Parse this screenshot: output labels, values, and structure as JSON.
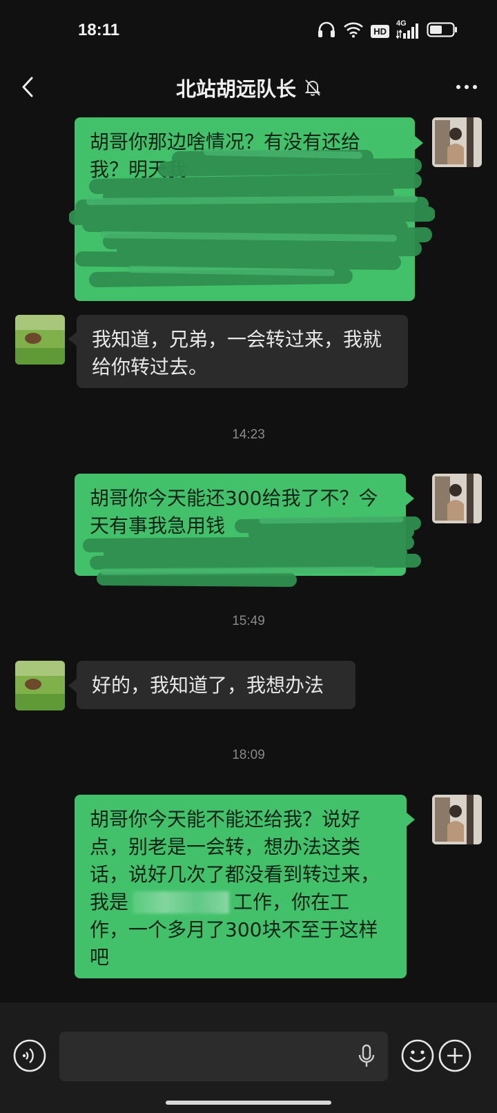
{
  "status_bar": {
    "time": "18:11",
    "icons": [
      "headphones-icon",
      "wifi-icon",
      "hd-icon",
      "4g-signal-icon",
      "battery-icon"
    ],
    "hd_label": "HD",
    "network_label": "4G"
  },
  "header": {
    "title": "北站胡远队长",
    "muted_icon": "bell-off-icon",
    "back_icon": "chevron-left-icon",
    "more_icon": "more-icon"
  },
  "messages": [
    {
      "sender": "self",
      "lines": [
        "胡哥你那边啥情况？有没有还给",
        "我？明天我"
      ]
    },
    {
      "sender": "friend",
      "lines": [
        "我知道，兄弟，一会转过来，我就",
        "给你转过去。"
      ]
    },
    {
      "timestamp": "14:23"
    },
    {
      "sender": "self",
      "lines": [
        "胡哥你今天能还300给我了不？今",
        "天有事我急用钱"
      ]
    },
    {
      "timestamp": "15:49"
    },
    {
      "sender": "friend",
      "lines": [
        "好的，我知道了，我想办法"
      ]
    },
    {
      "timestamp": "18:09"
    },
    {
      "sender": "self",
      "lines": [
        "胡哥你今天能不能还给我？说好",
        "点，别老是一会转，想办法这类",
        "话，说好几次了都没看到转过来，",
        "我是",
        "工作，你在工",
        "作，一个多月了300块不至于这样",
        "吧"
      ]
    }
  ],
  "input_bar": {
    "voice_icon": "voice-icon",
    "mic_icon": "mic-icon",
    "emoji_icon": "emoji-icon",
    "plus_icon": "plus-icon"
  },
  "colors": {
    "background": "#111111",
    "self_bubble": "#43c16a",
    "friend_bubble": "#2b2b2b"
  }
}
